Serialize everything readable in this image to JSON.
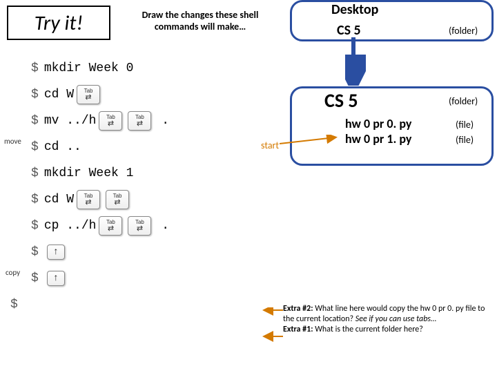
{
  "header": {
    "tryit": "Try it!",
    "instructions": "Draw the changes these shell commands will make…"
  },
  "side": {
    "move": "move",
    "copy": "copy"
  },
  "cmds": {
    "c1": "mkdir Week 0",
    "c2": "cd W",
    "c3a": "mv ../h",
    "dot": " .",
    "c4": "cd ..",
    "c5": "mkdir Week 1",
    "c6": "cd W",
    "c7a": "cp ../h",
    "prompt": "$"
  },
  "key": {
    "tab": "Tab",
    "tabarr": "⇄",
    "up": "↑"
  },
  "tree": {
    "desktop": "Desktop",
    "cs5a": "CS 5",
    "cs5b": "CS 5",
    "folder": "(folder)",
    "file": "(file)",
    "f1": "hw 0 pr 0. py",
    "f2": "hw 0 pr 1. py",
    "start": "start"
  },
  "extras": {
    "e2b": "Extra #2: ",
    "e2": "What line here would copy the hw 0 pr 0. py file to the current location? ",
    "e2i": "See if you can use tabs…",
    "e1b": "Extra #1: ",
    "e1": "What is the current folder here?"
  }
}
